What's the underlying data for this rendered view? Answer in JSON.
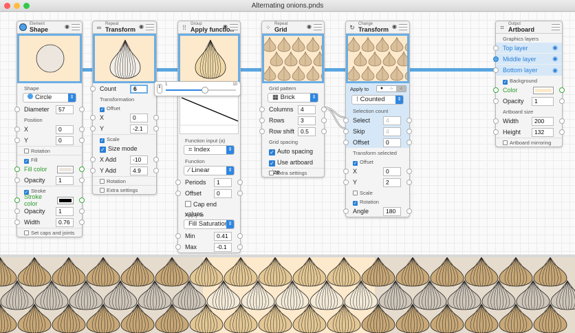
{
  "window": {
    "title": "Alternating onions.pnds"
  },
  "shape": {
    "category": "Element",
    "name": "Shape",
    "shape_label": "Shape",
    "shape_value": "Circle",
    "diameter_label": "Diameter",
    "diameter": "57",
    "position_label": "Position",
    "x_label": "X",
    "x": "0",
    "y_label": "Y",
    "y": "0",
    "rotation": "Rotation",
    "fill": "Fill",
    "fill_color_label": "Fill color",
    "fill_color": "#ece6de",
    "opacity_label": "Opacity",
    "opacity": "1",
    "stroke": "Stroke",
    "stroke_color_label": "Stroke color",
    "stroke_color": "#000000",
    "opacity2_label": "Opacity",
    "opacity2": "1",
    "width_label": "Width",
    "width": "0.76",
    "caps": "Set caps and joints"
  },
  "repeat": {
    "category": "Repeat",
    "name": "Transform",
    "count_label": "Count",
    "count": "6",
    "transformation": "Transformation",
    "offset": "Offset",
    "x_label": "X",
    "x": "0",
    "y_label": "Y",
    "y": "-2.1",
    "scale": "Scale",
    "size_mode": "Size mode",
    "xadd_label": "X Add",
    "xadd": "-10",
    "yadd_label": "Y Add",
    "yadd": "4.9",
    "rotation": "Rotation",
    "extra": "Extra settings"
  },
  "slider": {
    "min": "1",
    "max": "10",
    "value_fraction": 0.56
  },
  "apply": {
    "category": "Group",
    "name": "Apply function",
    "input_label": "Function input (a)",
    "input_value": "Index",
    "function_label": "Function",
    "function_value": "Linear",
    "periods_label": "Periods",
    "periods": "1",
    "offset_label": "Offset",
    "offset": "0",
    "cap": "Cap end values",
    "apply_label": "Apply to",
    "apply_value": "Fill Saturation",
    "min_label": "Min",
    "min": "0.41",
    "max_label": "Max",
    "max": "-0.1"
  },
  "grid": {
    "category": "Repeat",
    "name": "Grid",
    "pattern_label": "Grid pattern",
    "pattern_value": "Brick",
    "columns_label": "Columns",
    "columns": "4",
    "rows_label": "Rows",
    "rows": "3",
    "shift_label": "Row shift",
    "shift": "0.5",
    "spacing_label": "Grid spacing",
    "auto": "Auto spacing",
    "artboard": "Use artboard size",
    "extra": "Extra settings"
  },
  "change": {
    "category": "Change",
    "name": "Transform",
    "apply_label": "Apply to",
    "mode_value": "Counted",
    "selection_label": "Selection count",
    "select_label": "Select",
    "select": "4",
    "skip_label": "Skip",
    "skip": "4",
    "offset_label": "Offset",
    "offset": "0",
    "transform_label": "Transform selected",
    "offset_chk": "Offset",
    "x_label": "X",
    "x": "0",
    "y_label": "Y",
    "y": "2",
    "scale": "Scale",
    "rotation": "Rotation",
    "angle_label": "Angle",
    "angle": "180"
  },
  "artboard": {
    "category": "Output",
    "name": "Artboard",
    "layers_label": "Graphics layers",
    "layers": [
      "Top layer",
      "Middle layer",
      "Bottom layer"
    ],
    "background": "Background",
    "color_label": "Color",
    "color": "#fde9cc",
    "opacity_label": "Opacity",
    "opacity": "1",
    "size_label": "Artboard size",
    "width_label": "Width",
    "width": "200",
    "height_label": "Height",
    "height": "132",
    "mirroring": "Artboard mirroring"
  },
  "colors": {
    "accent": "#2f86e0",
    "wire": "#5aa6e0",
    "preview_bg": "#fde9cc"
  }
}
